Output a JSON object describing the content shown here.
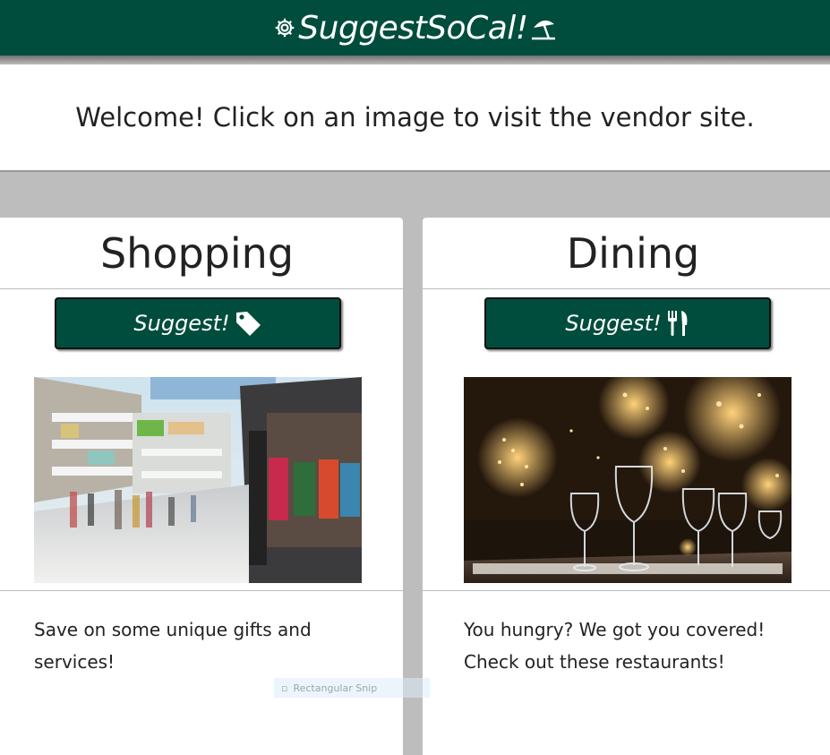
{
  "header": {
    "brand": "SuggestSoCal!",
    "left_icon": "gear-icon",
    "right_icon": "beach-umbrella-icon",
    "bg_color": "#004d3d"
  },
  "welcome": {
    "text": "Welcome! Click on an image to visit the vendor site."
  },
  "cards": {
    "shopping": {
      "title": "Shopping",
      "button_label": "Suggest!",
      "button_icon": "tag-icon",
      "image": "shopping-mall-image",
      "description": "Save on some unique gifts and services!"
    },
    "dining": {
      "title": "Dining",
      "button_label": "Suggest!",
      "button_icon": "utensils-icon",
      "image": "restaurant-table-image",
      "description": "You hungry? We got you covered! Check out these restaurants!"
    }
  },
  "overlay": {
    "snip_label": "Rectangular Snip"
  }
}
